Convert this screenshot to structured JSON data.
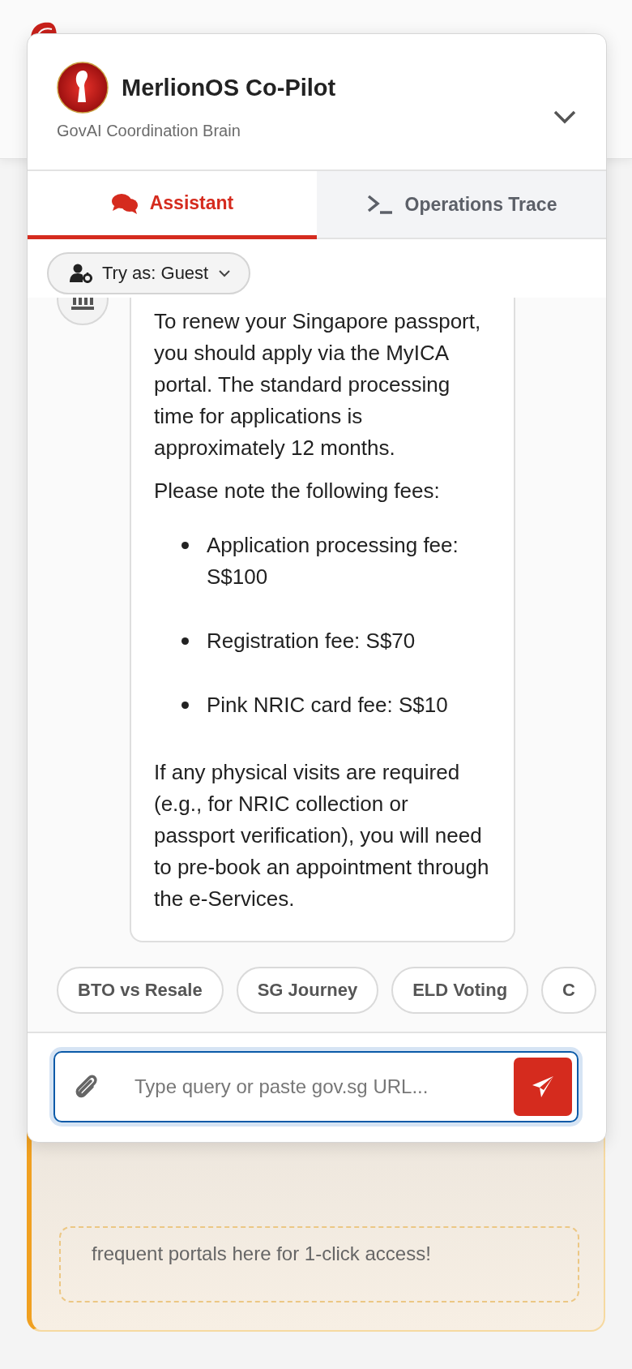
{
  "header": {
    "title": "MerlionOS Co-Pilot",
    "subtitle": "GovAI Coordination Brain"
  },
  "tabs": [
    {
      "label": "Assistant",
      "selected": true,
      "kind": "chat"
    },
    {
      "label": "Operations Trace",
      "selected": false,
      "kind": "terminal"
    }
  ],
  "role_selector": {
    "label": "Try as: Guest"
  },
  "messages": [
    {
      "kind": "agency",
      "blocks": [
        {
          "kind": "paragraph",
          "text": "To renew your Singapore passport, you should apply via the MyICA portal. The standard processing time for applications is approximately 12 months."
        },
        {
          "kind": "paragraph",
          "text": "Please note the following fees:"
        },
        {
          "kind": "list",
          "items": [
            "Application processing fee: S$100",
            "Registration fee: S$70",
            "Pink NRIC card fee: S$10"
          ]
        },
        {
          "kind": "paragraph",
          "text": "If any physical visits are required (e.g., for NRIC collection or passport verification), you will need to pre-book an appointment through the e-Services."
        }
      ]
    }
  ],
  "suggestions": [
    "BTO vs Resale",
    "SG Journey",
    "ELD Voting",
    "C"
  ],
  "composer": {
    "placeholder": "Type query or paste gov.sg URL..."
  },
  "background_card": {
    "text": "frequent portals here for 1-click access!"
  }
}
